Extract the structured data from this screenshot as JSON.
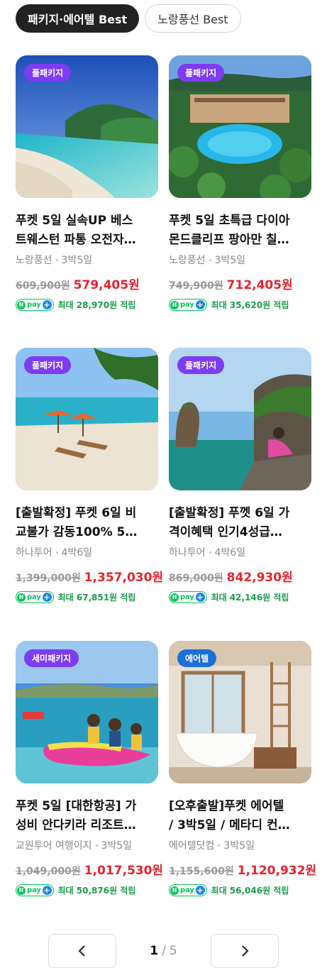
{
  "tabs": [
    {
      "label": "패키지·에어텔 Best",
      "active": true
    },
    {
      "label": "노랑풍선 Best",
      "active": false
    }
  ],
  "products": [
    {
      "badge": "풀패키지",
      "title_line1": "푸켓 5일 실속UP 베스",
      "title_line2": "트웨스턴 파통 오전자…",
      "seller": "노랑풍선",
      "duration": "3박5일",
      "original_price": "609,900원",
      "sale_price": "579,405원",
      "npay_text": "최대 28,970원 적립"
    },
    {
      "badge": "풀패키지",
      "title_line1": "푸켓 5일 초특급 다이아",
      "title_line2": "몬드클리프 팡아만 칠…",
      "seller": "노랑풍선",
      "duration": "3박5일",
      "original_price": "749,900원",
      "sale_price": "712,405원",
      "npay_text": "최대 35,620원 적립"
    },
    {
      "badge": "풀패키지",
      "title_line1": "[출발확정] 푸켓 6일 비",
      "title_line2": "교불가 감동100% 5…",
      "seller": "하나투어",
      "duration": "4박6일",
      "original_price": "1,399,000원",
      "sale_price": "1,357,030원",
      "npay_text": "최대 67,851원 적립"
    },
    {
      "badge": "풀패키지",
      "title_line1": "[출발확정] 푸껫 6일 가",
      "title_line2": "격이혜택 인기4성급…",
      "seller": "하나투어",
      "duration": "4박6일",
      "original_price": "869,000원",
      "sale_price": "842,930원",
      "npay_text": "최대 42,146원 적립"
    },
    {
      "badge": "세미패키지",
      "title_line1": "푸켓 5일 [대한항공] 가",
      "title_line2": "성비 안다키라 리조트…",
      "seller": "교원투어 여행이지",
      "duration": "3박5일",
      "original_price": "1,049,000원",
      "sale_price": "1,017,530원",
      "npay_text": "최대 50,876원 적립"
    },
    {
      "badge": "에어텔",
      "title_line1": "[오후출발]푸켓 에어텔",
      "title_line2": "/ 3박5일 / 메타디 컨…",
      "seller": "에어텔닷컴",
      "duration": "3박5일",
      "original_price": "1,155,600원",
      "sale_price": "1,120,932원",
      "npay_text": "최대 56,046원 적립"
    }
  ],
  "npay": {
    "n": "N",
    "pay": "pay",
    "plus": "+"
  },
  "pagination": {
    "current": "1",
    "separator": "/",
    "total": "5"
  },
  "colors": {
    "sale": "#e5242b",
    "npay_green": "#03c75a",
    "badge_purple": "#7d3cf2",
    "badge_blue": "#1c6fd6"
  }
}
